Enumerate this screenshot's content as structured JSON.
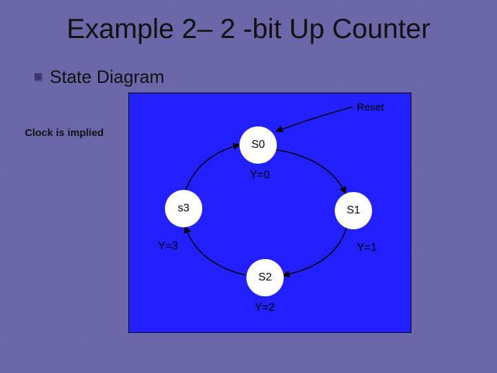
{
  "title": "Example 2– 2 -bit Up Counter",
  "subtitle": "State Diagram",
  "note": "Clock is implied",
  "diagram": {
    "reset_label": "Reset",
    "states": {
      "s0": "S0",
      "s1": "S1",
      "s2": "S2",
      "s3": "s3"
    },
    "outputs": {
      "y0": "Y=0",
      "y1": "Y=1",
      "y2": "Y=2",
      "y3": "Y=3"
    }
  }
}
